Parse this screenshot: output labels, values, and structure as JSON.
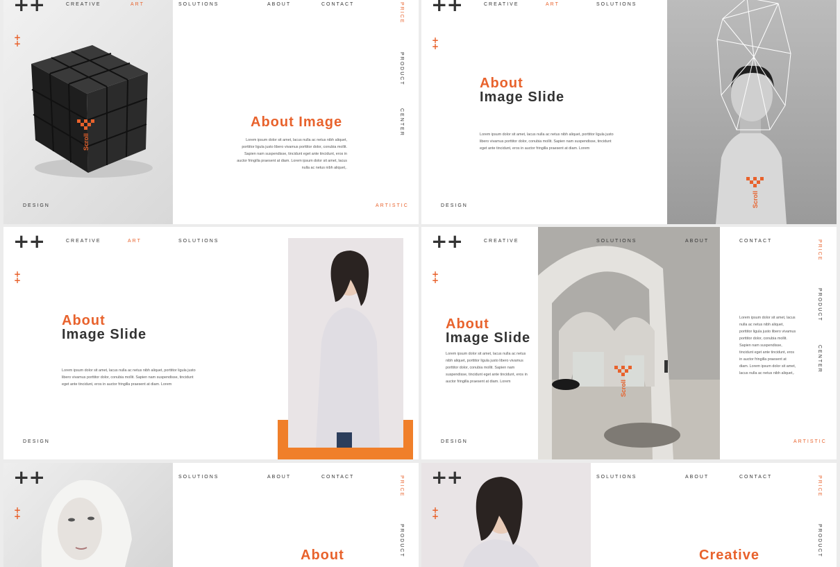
{
  "logo": "++",
  "plus_small": "+\n+",
  "nav": {
    "creative": "CREATIVE",
    "art": "ART",
    "solutions": "SOLUTIONS",
    "about": "ABOUT",
    "contact": "CONTACT"
  },
  "side": {
    "price": "PRICE",
    "product": "PRODUCT",
    "center": "CENTER"
  },
  "footer": {
    "design": "DESIGN",
    "artistic": "ARTISTIC"
  },
  "scroll_label": "Scroll",
  "slide1": {
    "title": "About Image",
    "body": "Lorem ipsum dolor sit amet, lacus nulla ac netus nibh aliquet, porttitor ligula justo libero vivamus porttitor dolor, conubia mollit. Sapien nam suspendisse, tincidunt eget ante tincidunt, eros in auctor fringilla praesent at diam. Lorem ipsum dolor sit amet, lacus nulla ac netus nibh aliquet,."
  },
  "slide2": {
    "title_orange": "About",
    "title_dark": "Image Slide",
    "body": "Lorem ipsum dolor sit amet, lacus nulla ac netus nibh aliquet, porttitor ligula justo libero vivamus porttitor dolor, conubia mollit. Sapien nam suspendisse, tincidunt eget ante tincidunt, eros in auctor fringilla praesent at diam. Lorem"
  },
  "slide3": {
    "title_orange": "About",
    "title_dark": "Image Slide",
    "body": "Lorem ipsum dolor sit amet, lacus nulla ac netus nibh aliquet, porttitor ligula justo libero vivamus porttitor dolor, conubia mollit. Sapien nam suspendisse, tincidunt eget ante tincidunt, eros in auctor fringilla praesent at diam. Lorem"
  },
  "slide4": {
    "title_orange": "About",
    "title_dark": "Image Slide",
    "body_left": "Lorem ipsum dolor sit amet, lacus nulla ac netus nibh aliquet, porttitor ligula justo libero vivamus porttitor dolor, conubia mollit. Sapien nam suspendisse, tincidunt eget ante tincidunt, eros in auctor fringilla praesent at diam. Lorem",
    "body_right": "Lorem ipsum dolor sit amet, lacus nulla ac netus nibh aliquet, porttitor ligula justo libero vivamus porttitor dolor, conubia mollit. Sapien nam suspendisse, tincidunt eget ante tincidunt, eros in auctor fringilla praesent at diam. Lorem ipsum dolor sit amet, lacus nulla ac netus nibh aliquet,."
  },
  "slide5": {
    "title_orange": "About"
  },
  "slide6": {
    "title_orange": "Creative"
  }
}
